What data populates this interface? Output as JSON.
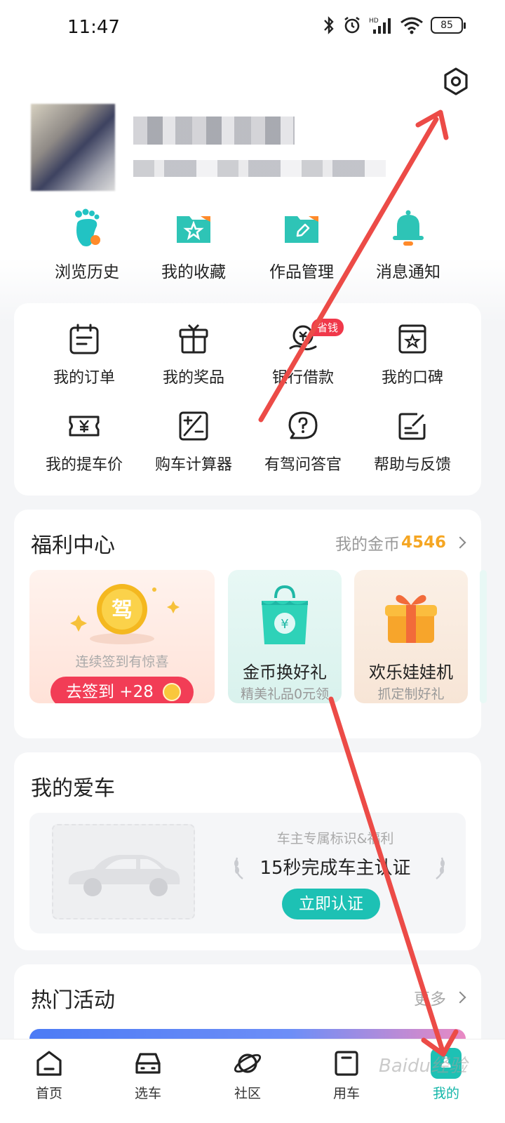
{
  "status_bar": {
    "time": "11:47",
    "battery": "85"
  },
  "settings": {
    "icon": "hexagon-settings-icon"
  },
  "profile": {
    "username": "",
    "info": ""
  },
  "quick_actions": [
    {
      "label": "浏览历史",
      "icon": "footprint-icon",
      "color": "#22c3c3"
    },
    {
      "label": "我的收藏",
      "icon": "star-folder-icon",
      "color": "#2ec4b6"
    },
    {
      "label": "作品管理",
      "icon": "pen-folder-icon",
      "color": "#2ec4b6"
    },
    {
      "label": "消息通知",
      "icon": "bell-icon",
      "color": "#2ec4b6"
    }
  ],
  "services": [
    {
      "label": "我的订单",
      "icon": "calendar-list-icon"
    },
    {
      "label": "我的奖品",
      "icon": "gift-box-icon"
    },
    {
      "label": "银行借款",
      "icon": "money-hand-icon",
      "badge": "省钱"
    },
    {
      "label": "我的口碑",
      "icon": "star-bookmark-icon"
    },
    {
      "label": "我的提车价",
      "icon": "yen-ticket-icon"
    },
    {
      "label": "购车计算器",
      "icon": "calculator-icon"
    },
    {
      "label": "有驾问答官",
      "icon": "question-bubble-icon"
    },
    {
      "label": "帮助与反馈",
      "icon": "edit-feedback-icon"
    }
  ],
  "welfare": {
    "title": "福利中心",
    "coins_label": "我的金币",
    "coins_value": "4546",
    "checkin": {
      "coin_text": "驾",
      "hint": "连续签到有惊喜",
      "button": "去签到 +28"
    },
    "gift": {
      "title": "金币换好礼",
      "subtitle": "精美礼品0元领"
    },
    "claw": {
      "title": "欢乐娃娃机",
      "subtitle": "抓定制好礼"
    }
  },
  "my_car": {
    "title": "我的爱车",
    "hint": "车主专属标识&福利",
    "headline": "15秒完成车主认证",
    "button": "立即认证"
  },
  "hot_events": {
    "title": "热门活动",
    "more": "更多"
  },
  "bottom_nav": [
    {
      "label": "首页",
      "icon": "home-icon"
    },
    {
      "label": "选车",
      "icon": "car-front-icon"
    },
    {
      "label": "社区",
      "icon": "planet-icon"
    },
    {
      "label": "用车",
      "icon": "box-icon"
    },
    {
      "label": "我的",
      "icon": "me-icon",
      "active": true
    }
  ],
  "watermark": "Baidu经验",
  "colors": {
    "accent": "#1dc1b4",
    "checkin_red": "#f23d56",
    "coins_gold": "#f5a623",
    "annotation": "#ec4b47"
  }
}
